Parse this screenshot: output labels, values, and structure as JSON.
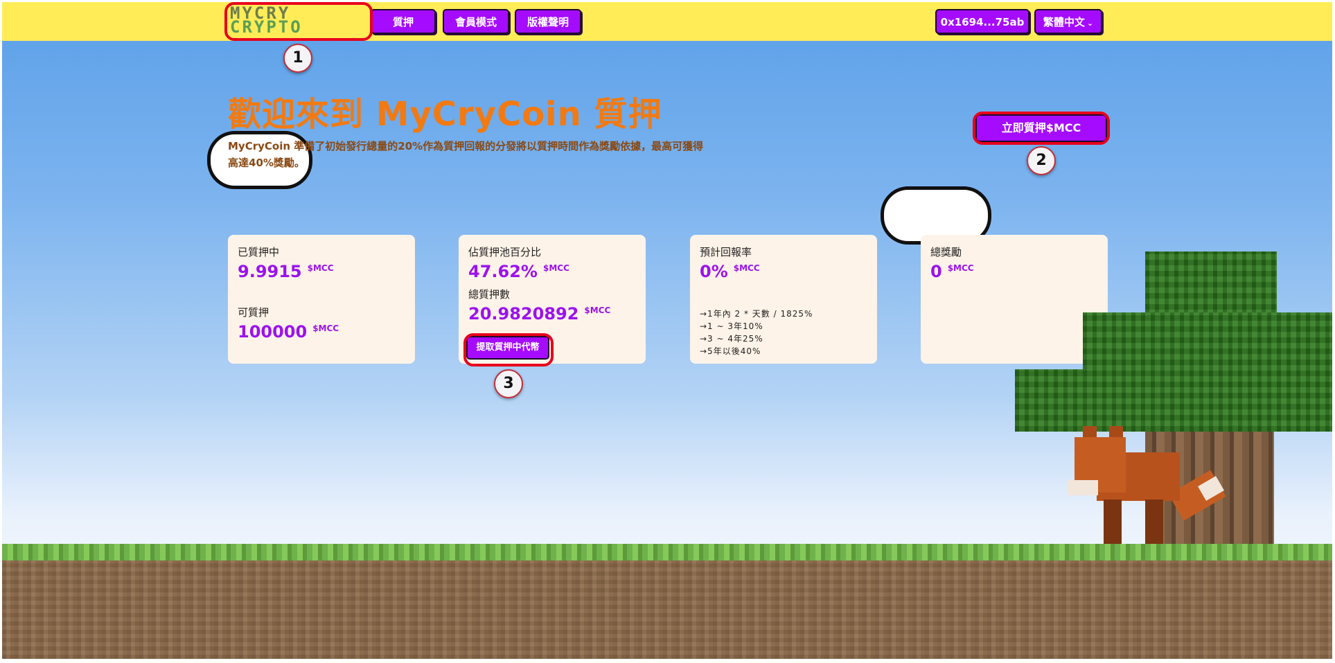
{
  "nav": {
    "logo_line1": "MYCRY",
    "logo_line2": "CRYPTO",
    "stake": "質押",
    "member": "會員模式",
    "copyright": "版權聲明",
    "wallet": "0x1694...75ab",
    "language": "繁體中文"
  },
  "hero": {
    "title": "歡迎來到 MyCryCoin 質押",
    "desc_brand": "MyCryCoin",
    "desc_part1": " 準備了初始發行總量的",
    "desc_pct1": "20%",
    "desc_part2": "作為質押回報的分發將以質押時間作為獎勵依據，最高可獲得高達",
    "desc_pct2": "40%",
    "desc_part3": "獎勵。",
    "stake_now": "立即質押$MCC"
  },
  "cards": {
    "staked_label": "已質押中",
    "staked_value": "9.9915",
    "stakable_label": "可質押",
    "stakable_value": "100000",
    "pool_pct_label": "佔質押池百分比",
    "pool_pct_value": "47.62%",
    "total_staked_label": "總質押數",
    "total_staked_value": "20.9820892",
    "withdraw_button": "提取質押中代幣",
    "apr_label": "預計回報率",
    "apr_value": "0%",
    "rates": [
      "→1年內 2 * 天數 / 1825%",
      "→1 ~ 3年10%",
      "→3 ~ 4年25%",
      "→5年以後40%"
    ],
    "reward_label": "總獎勵",
    "reward_value": "0",
    "unit": "$MCC"
  },
  "markers": [
    "1",
    "2",
    "3"
  ],
  "colors": {
    "topbar": "#ffec57",
    "accent_purple": "#a50cff",
    "title_orange": "#f27a11",
    "highlight_red": "#e8001c"
  }
}
